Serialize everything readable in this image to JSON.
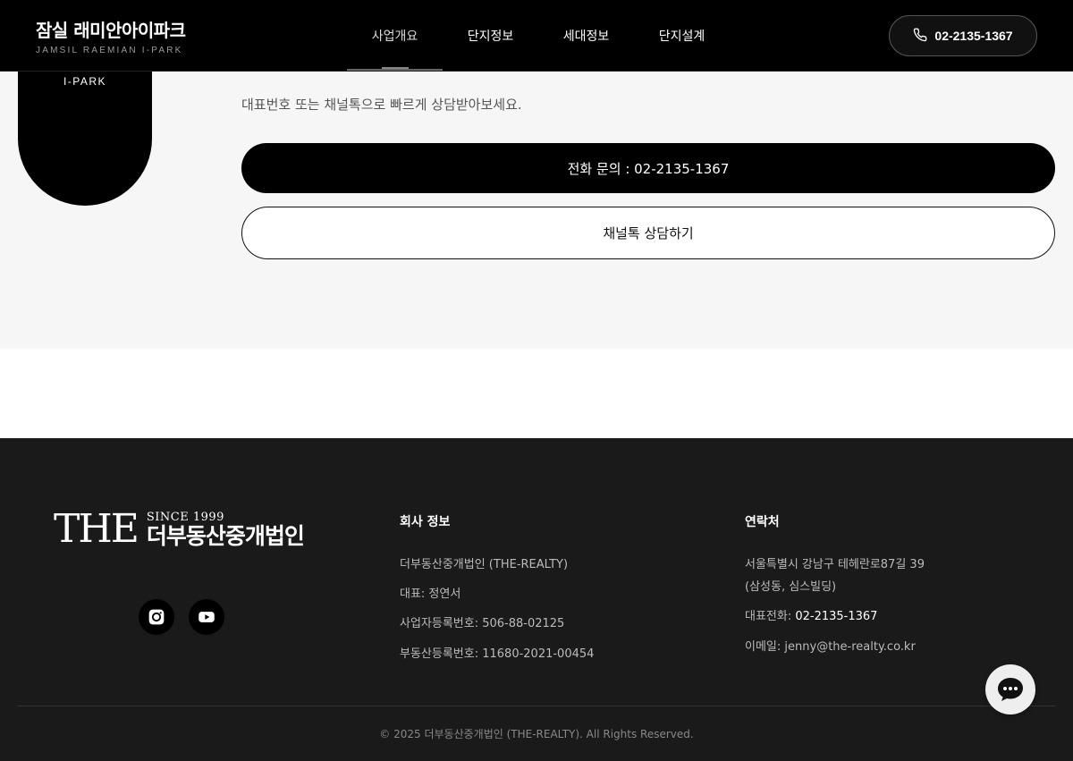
{
  "header": {
    "brand_title": "잠실 래미안아이파크",
    "brand_sub": "JAMSIL RAEMIAN I-PARK",
    "nav": [
      "사업개요",
      "단지정보",
      "세대정보",
      "단지설계"
    ],
    "phone": "02-2135-1367"
  },
  "consult": {
    "badge_text": "I-PARK",
    "description": "대표번호 또는 채널톡으로 빠르게 상담받아보세요.",
    "call_button": "전화 문의 : 02-2135-1367",
    "kakao_button": "채널톡 상담하기"
  },
  "footer": {
    "logo_the": "THE",
    "logo_since": "SINCE 1999",
    "logo_name": "더부동산중개법인",
    "company_title": "회사 정보",
    "company_lines": [
      "더부동산중개법인 (THE-REALTY)",
      "대표: 정연서",
      "사업자등록번호: 506-88-02125",
      "부동산등록번호: 11680-2021-00454"
    ],
    "contact_title": "연락처",
    "address_line1": "서울특별시 강남구 테헤란로87길 39",
    "address_line2": "(삼성동, 심스빌딩)",
    "phone_label": "대표전화: ",
    "phone_value": "02-2135-1367",
    "email_label": "이메일: ",
    "email_value": "jenny@the-realty.co.kr",
    "copyright": "© 2025 더부동산중개법인 (THE-REALTY). All Rights Reserved."
  },
  "icons": {
    "phone": "phone-icon",
    "instagram": "instagram-icon",
    "youtube": "youtube-icon",
    "chat": "chat-icon"
  },
  "colors": {
    "header_bg": "#000000",
    "footer_bg": "#1a1a1a",
    "section_bg": "#f6f6f6"
  }
}
